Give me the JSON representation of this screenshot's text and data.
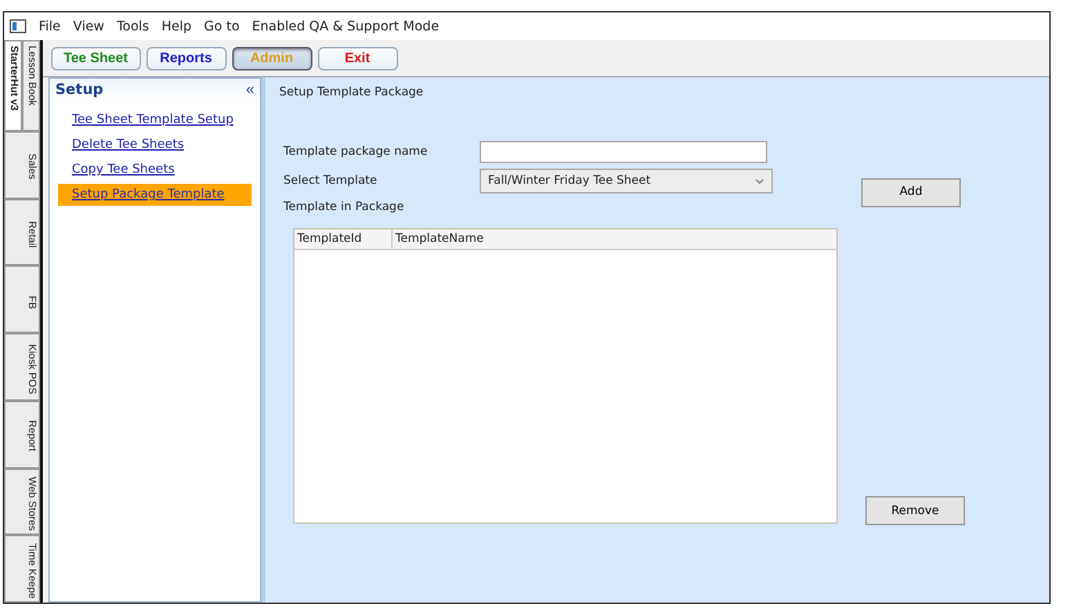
{
  "menu": [
    "File",
    "View",
    "Tools",
    "Help",
    "Go to",
    "Enabled QA & Support Mode"
  ],
  "toolbar": [
    {
      "label": "Tee Sheet",
      "color": "#1e8a1e",
      "selected": false
    },
    {
      "label": "Reports",
      "color": "#1a1ad0",
      "selected": false
    },
    {
      "label": "Admin",
      "color": "#d8a020",
      "selected": true
    },
    {
      "label": "Exit",
      "color": "#e01818",
      "selected": false
    }
  ],
  "side_tabs_top": [
    {
      "label": "StarterHut v3",
      "selected": true
    },
    {
      "label": "Lesson Book",
      "selected": false
    }
  ],
  "side_tabs": [
    {
      "label": "Sales",
      "selected": false
    },
    {
      "label": "Retail",
      "selected": false
    },
    {
      "label": "FB",
      "selected": false
    },
    {
      "label": "Kiosk POS",
      "selected": false
    },
    {
      "label": "Report",
      "selected": false
    },
    {
      "label": "Web Stores",
      "selected": false
    },
    {
      "label": "Time Keepe",
      "selected": false
    }
  ],
  "sidebar": {
    "title": "Setup",
    "collapse": "«",
    "items": [
      {
        "label": "Tee Sheet Template Setup",
        "selected": false
      },
      {
        "label": "Delete Tee Sheets",
        "selected": false
      },
      {
        "label": "Copy Tee Sheets",
        "selected": false
      },
      {
        "label": "Setup Package Template",
        "selected": true
      }
    ]
  },
  "main": {
    "title": "Setup Template Package",
    "name_label": "Template package name",
    "select_label": "Select Template",
    "select_value": "Fall/Winter Friday Tee Sheet",
    "list_label": "Template in Package",
    "columns": [
      "TemplateId",
      "TemplateName"
    ],
    "add_button": "Add",
    "remove_button": "Remove"
  }
}
